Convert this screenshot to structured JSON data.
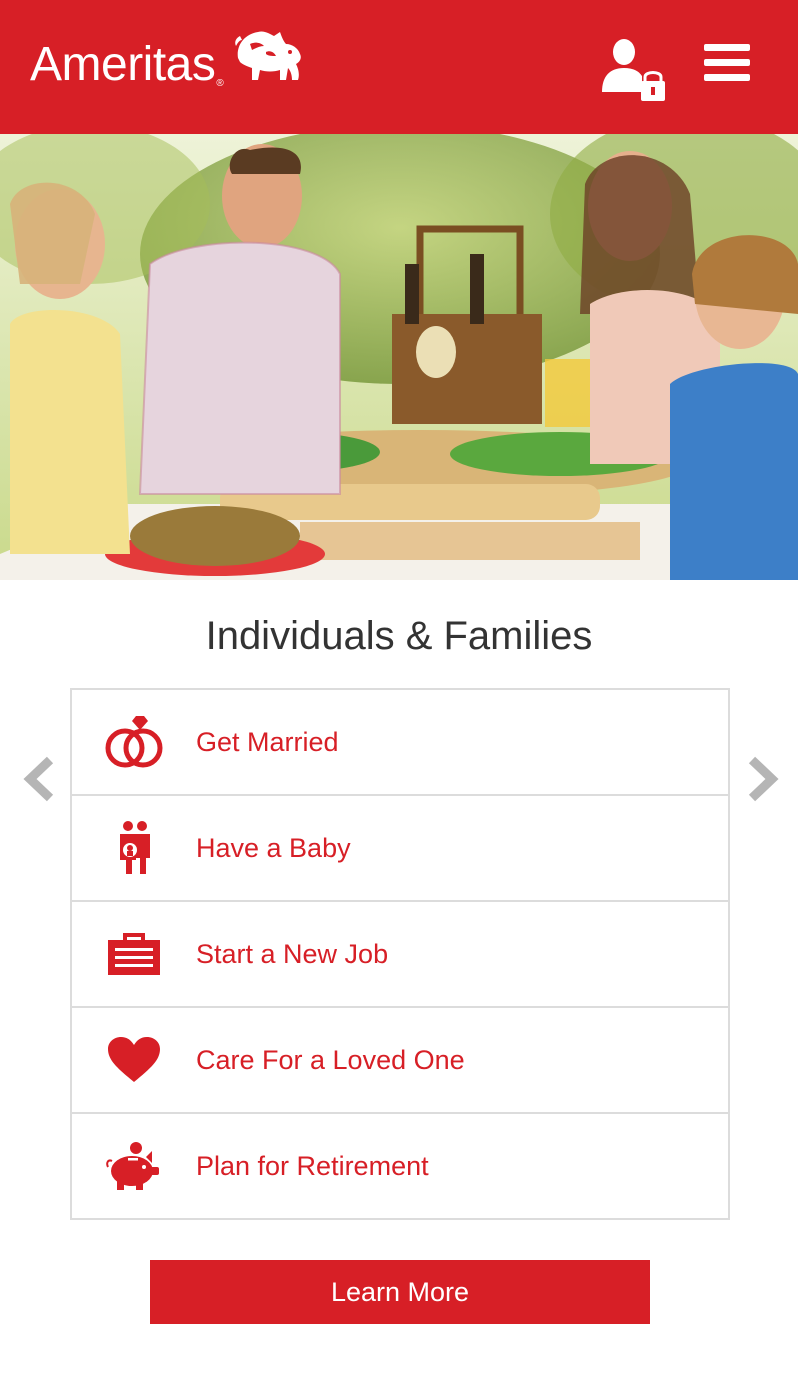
{
  "header": {
    "logo_text": "Ameritas",
    "logo_reg": "®",
    "login_icon": "user-lock-icon",
    "menu_icon": "hamburger-menu-icon"
  },
  "hero": {
    "image": "family-picnic-photo"
  },
  "section": {
    "title": "Individuals & Families"
  },
  "carousel": {
    "prev_icon": "chevron-left-icon",
    "next_icon": "chevron-right-icon"
  },
  "events": [
    {
      "label": "Get Married",
      "icon": "wedding-rings-icon"
    },
    {
      "label": "Have a Baby",
      "icon": "family-baby-icon"
    },
    {
      "label": "Start a New Job",
      "icon": "briefcase-icon"
    },
    {
      "label": "Care For a Loved One",
      "icon": "heart-icon"
    },
    {
      "label": "Plan for Retirement",
      "icon": "piggy-bank-icon"
    }
  ],
  "cta": {
    "label": "Learn More"
  },
  "colors": {
    "brand_red": "#d71f26",
    "text_dark": "#333333",
    "border": "#dcdcdc",
    "arrow_gray": "#b5b5b5"
  }
}
